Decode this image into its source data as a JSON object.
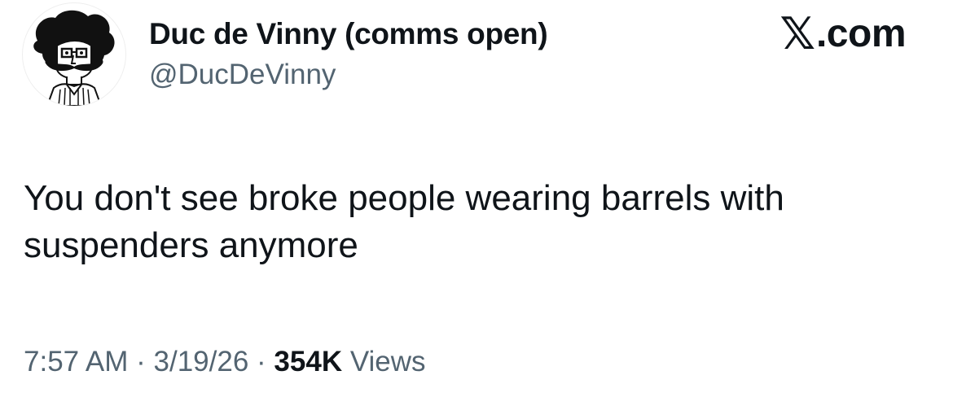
{
  "tweet": {
    "author": {
      "display_name": "Duc de Vinny (comms open)",
      "handle": "@DucDeVinny",
      "avatar_icon": "cartoon-avatar-icon"
    },
    "source": {
      "logo": "𝕏",
      "label": ".com"
    },
    "text": "You don't see broke people wearing barrels with suspenders anymore",
    "meta": {
      "time": "7:57 AM",
      "separator": " · ",
      "date": "3/19/26",
      "views_count": "354K",
      "views_label": " Views"
    }
  }
}
